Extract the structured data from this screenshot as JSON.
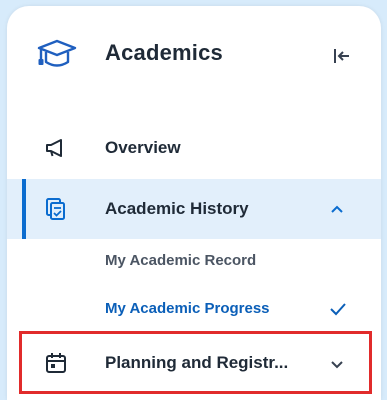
{
  "header": {
    "title": "Academics",
    "icon": "mortarboard-icon"
  },
  "nav": {
    "overview": {
      "label": "Overview",
      "icon": "megaphone-icon"
    },
    "history": {
      "label": "Academic History",
      "icon": "document-stack-icon",
      "expanded": true,
      "sub_items": [
        {
          "label": "My Academic Record",
          "selected": false
        },
        {
          "label": "My Academic Progress",
          "selected": true
        }
      ]
    },
    "planning": {
      "label": "Planning and Registr...",
      "icon": "calendar-icon",
      "expanded": false
    }
  },
  "colors": {
    "accent": "#0b6ccf",
    "active_bg": "#e2effb",
    "text": "#1f2a37",
    "highlight": "#e12b2b",
    "page_bg": "#d7ebfb"
  }
}
